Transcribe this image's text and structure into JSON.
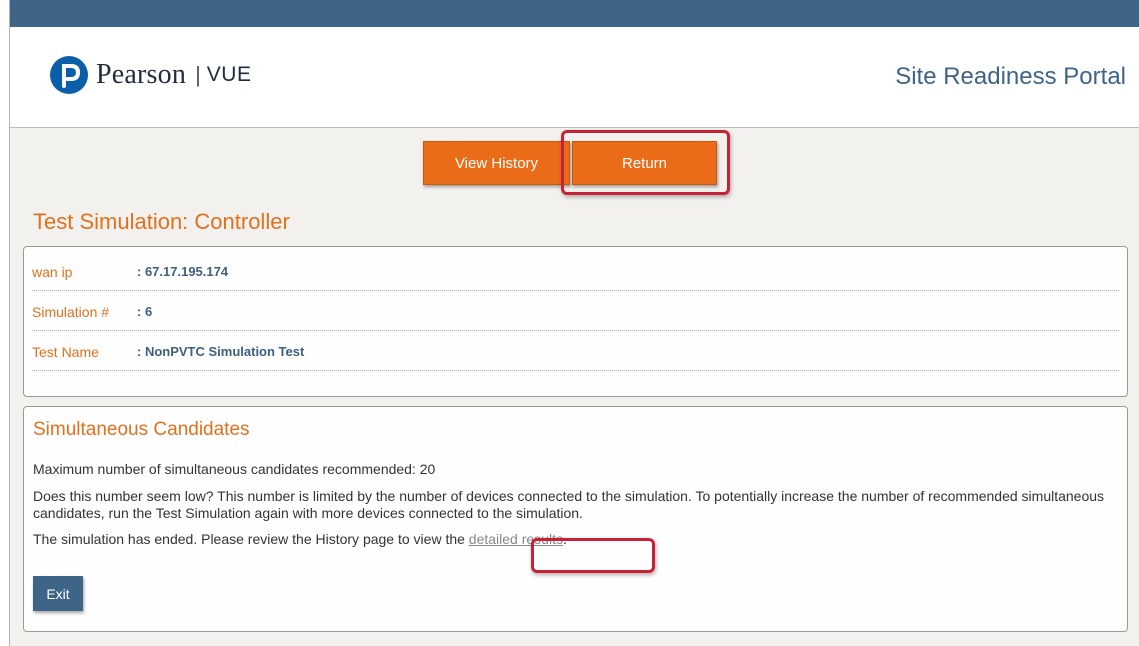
{
  "header": {
    "logo_word": "Pearson",
    "logo_separator": "|",
    "logo_vue": "VUE",
    "portal_title": "Site Readiness Portal"
  },
  "toolbar": {
    "view_history_label": "View History",
    "return_label": "Return"
  },
  "page_title": "Test Simulation: Controller",
  "info": {
    "rows": [
      {
        "label": "wan ip",
        "value": ": 67.17.195.174"
      },
      {
        "label": "Simulation #",
        "value": ": 6"
      },
      {
        "label": "Test Name",
        "value": ": NonPVTC Simulation Test"
      }
    ]
  },
  "candidates": {
    "title": "Simultaneous Candidates",
    "max_text": "Maximum number of simultaneous candidates recommended: 20",
    "low_text": "Does this number seem low? This number is limited by the number of devices connected to the simulation. To potentially increase the number of recommended simultaneous candidates, run the Test Simulation again with more devices connected to the simulation.",
    "ended_text": "The simulation has ended. Please review the History page to view the ",
    "link_text": "detailed results",
    "ended_suffix": ".",
    "exit_label": "Exit"
  },
  "colors": {
    "accent_orange": "#ea6c18",
    "brand_blue": "#3e6487",
    "highlight_red": "#c72136"
  }
}
